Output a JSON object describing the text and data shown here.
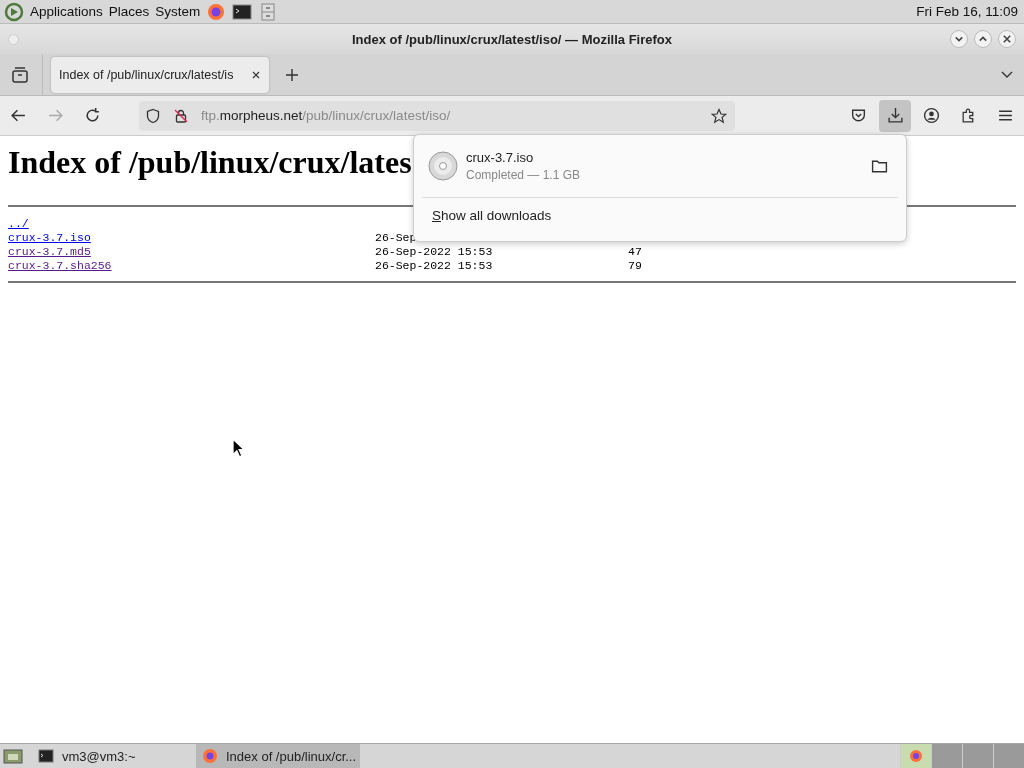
{
  "top_panel": {
    "menus": [
      "Applications",
      "Places",
      "System"
    ],
    "clock": "Fri Feb 16, 11:09"
  },
  "window": {
    "title": "Index of /pub/linux/crux/latest/iso/ — Mozilla Firefox"
  },
  "tabs": [
    {
      "label": "Index of /pub/linux/crux/latest/is",
      "selected": true
    }
  ],
  "address_bar": {
    "prefix": "ftp.",
    "domain": "morpheus.net",
    "path": "/pub/linux/crux/latest/iso/"
  },
  "page": {
    "heading": "Index of /pub/linux/crux/lates",
    "rows": [
      {
        "name": "../"
      },
      {
        "name": "crux-3.7.iso",
        "date": "26-Sep"
      },
      {
        "name": "crux-3.7.md5",
        "date": "26-Sep-2022 15:53",
        "size": "47"
      },
      {
        "name": "crux-3.7.sha256",
        "date": "26-Sep-2022 15:53",
        "size": "79"
      }
    ]
  },
  "downloads_panel": {
    "items": [
      {
        "file": "crux-3.7.iso",
        "status": "Completed — 1.1 GB"
      }
    ],
    "show_all": "Show all downloads"
  },
  "taskbar": {
    "items": [
      {
        "kind": "terminal",
        "label": "vm3@vm3:~",
        "selected": false
      },
      {
        "kind": "browser",
        "label": "Index of /pub/linux/cr...",
        "selected": true
      }
    ]
  }
}
